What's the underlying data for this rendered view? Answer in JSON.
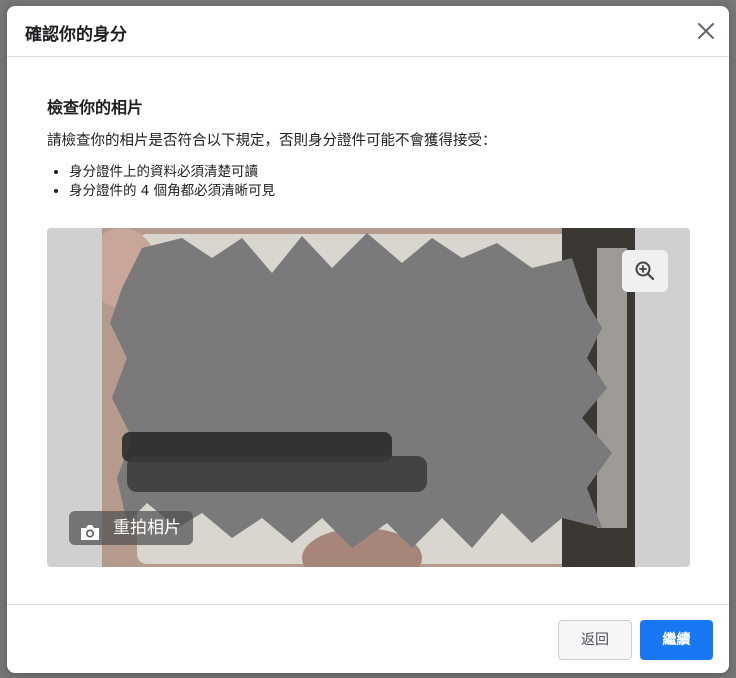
{
  "dialog": {
    "title": "確認你的身分"
  },
  "content": {
    "section_title": "檢查你的相片",
    "instruction": "請檢查你的相片是否符合以下規定，否則身分證件可能不會獲得接受：",
    "rules": [
      "身分證件上的資料必須清楚可讀",
      "身分證件的 4 個角都必須清晰可見"
    ]
  },
  "photo": {
    "retake_label": "重拍相片",
    "retake_icon": "camera-icon",
    "zoom_icon": "zoom-in-icon"
  },
  "footer": {
    "back_label": "返回",
    "continue_label": "繼續"
  },
  "colors": {
    "primary": "#1877f2",
    "redaction": "#7a7a7a"
  }
}
